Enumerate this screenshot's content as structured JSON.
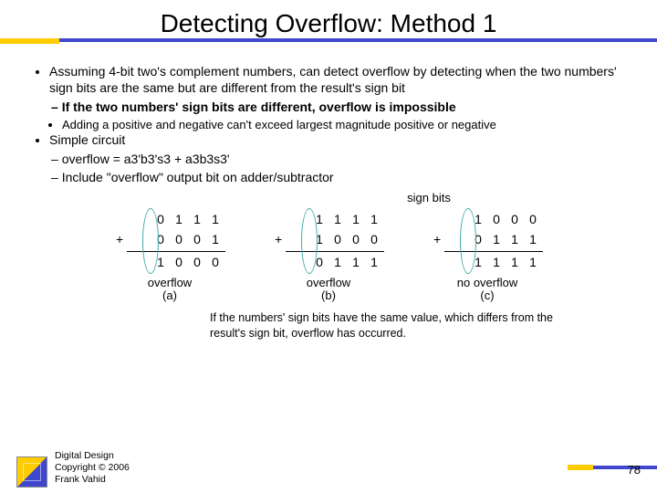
{
  "title": "Detecting Overflow: Method 1",
  "bullets": {
    "b1": "Assuming 4-bit two's complement numbers, can detect overflow by detecting when the two numbers' sign bits are the same but are different from the result's sign bit",
    "b1s1": "If the two numbers' sign bits are different, overflow is impossible",
    "b1s1a": "Adding a positive and negative can't exceed largest magnitude positive or negative",
    "b2": "Simple circuit",
    "b2s1": "overflow = a3'b3's3 + a3b3s3'",
    "b2s2": "Include \"overflow\" output bit on adder/subtractor"
  },
  "signBitsLabel": "sign bits",
  "examples": [
    {
      "op1": [
        "0",
        "1",
        "1",
        "1"
      ],
      "op2": [
        "0",
        "0",
        "0",
        "1"
      ],
      "res": [
        "1",
        "0",
        "0",
        "0"
      ],
      "caption1": "overflow",
      "caption2": "(a)"
    },
    {
      "op1": [
        "1",
        "1",
        "1",
        "1"
      ],
      "op2": [
        "1",
        "0",
        "0",
        "0"
      ],
      "res": [
        "0",
        "1",
        "1",
        "1"
      ],
      "caption1": "overflow",
      "caption2": "(b)"
    },
    {
      "op1": [
        "1",
        "0",
        "0",
        "0"
      ],
      "op2": [
        "0",
        "1",
        "1",
        "1"
      ],
      "res": [
        "1",
        "1",
        "1",
        "1"
      ],
      "caption1": "no overflow",
      "caption2": "(c)"
    }
  ],
  "plusSign": "+",
  "bottomNote": "If the numbers' sign bits have the same value, which differs from the result's sign bit, overflow has occurred.",
  "credits": {
    "l1": "Digital Design",
    "l2": "Copyright © 2006",
    "l3": "Frank Vahid"
  },
  "pageNumber": "78"
}
